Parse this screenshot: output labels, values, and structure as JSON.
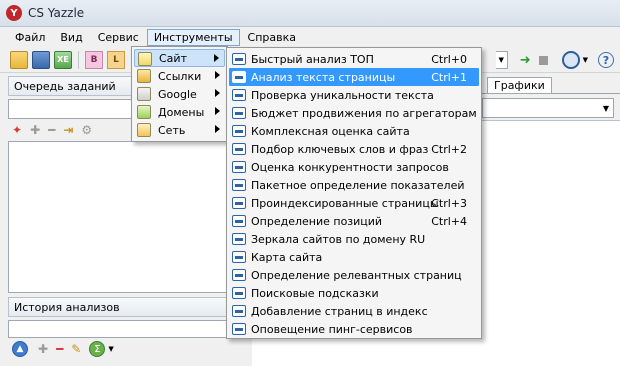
{
  "window": {
    "title": "CS Yazzle",
    "logo_letter": "Y"
  },
  "menubar": [
    "Файл",
    "Вид",
    "Сервис",
    "Инструменты",
    "Справка"
  ],
  "toolbar": {
    "b_label": "B",
    "l_label": "L",
    "export_label": "XE",
    "help_label": "?",
    "dropdown_arrow": "▼"
  },
  "left_pane": {
    "queue_title": "Очередь заданий",
    "history_title": "История анализов",
    "icons": {
      "add": "✚",
      "remove": "━",
      "sigma": "Σ",
      "up": "▲"
    }
  },
  "right_area": {
    "tab_graphs": "Графики",
    "combo_arrow": "▼"
  },
  "instruments_menu": [
    {
      "label": "Сайт",
      "icon": "site-icon",
      "has_submenu": true,
      "highlighted": true
    },
    {
      "label": "Ссылки",
      "icon": "links-icon",
      "has_submenu": true
    },
    {
      "label": "Google",
      "icon": "google-icon",
      "has_submenu": true
    },
    {
      "label": "Домены",
      "icon": "domains-icon",
      "has_submenu": true
    },
    {
      "label": "Сеть",
      "icon": "network-icon",
      "has_submenu": true
    }
  ],
  "site_menu": [
    {
      "label": "Быстрый анализ ТОП",
      "shortcut": "Ctrl+0"
    },
    {
      "label": "Анализ текста страницы",
      "shortcut": "Ctrl+1",
      "highlighted": true
    },
    {
      "label": "Проверка уникальности текста",
      "shortcut": ""
    },
    {
      "label": "Бюджет продвижения по агрегаторам",
      "shortcut": ""
    },
    {
      "label": "Комплексная оценка сайта",
      "shortcut": ""
    },
    {
      "label": "Подбор ключевых слов и фраз",
      "shortcut": "Ctrl+2"
    },
    {
      "label": "Оценка конкурентности запросов",
      "shortcut": ""
    },
    {
      "label": "Пакетное определение показателей",
      "shortcut": ""
    },
    {
      "label": "Проиндексированные страницы",
      "shortcut": "Ctrl+3"
    },
    {
      "label": "Определение позиций",
      "shortcut": "Ctrl+4"
    },
    {
      "label": "Зеркала сайтов по домену RU",
      "shortcut": ""
    },
    {
      "label": "Карта сайта",
      "shortcut": ""
    },
    {
      "label": "Определение релевантных страниц",
      "shortcut": ""
    },
    {
      "label": "Поисковые подсказки",
      "shortcut": ""
    },
    {
      "label": "Добавление страниц в индекс",
      "shortcut": ""
    },
    {
      "label": "Оповещение пинг-сервисов",
      "shortcut": ""
    }
  ]
}
